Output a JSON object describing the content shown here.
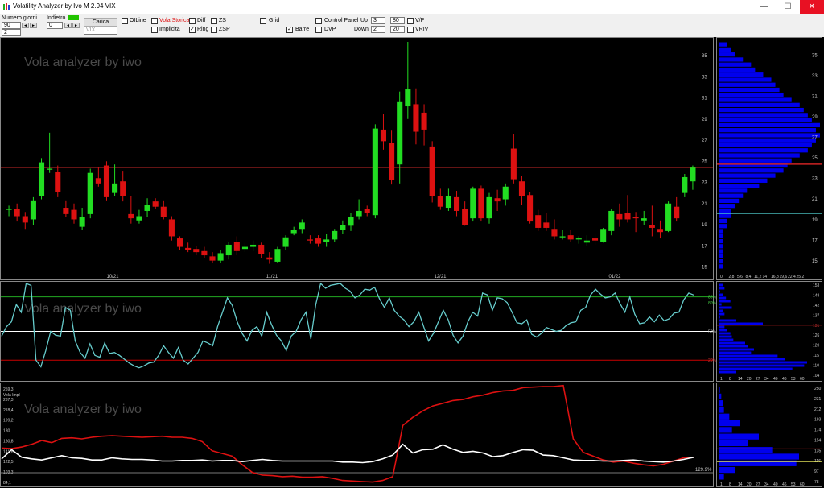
{
  "window": {
    "title": "Volatility Analyzer by Ivo M 2.94  VIX",
    "min": "—",
    "max": "☐",
    "close": "✕"
  },
  "toolbar": {
    "days_label": "Numero giorni",
    "days_value": "90",
    "days_value2": "2",
    "back_label": "Indietro",
    "back_value": "0",
    "load_label": "Carica",
    "symbol_placeholder": "VIX",
    "checks": {
      "oiline": "OILine",
      "vola_storica": "Vola Storica",
      "diff": "Diff",
      "zs": "ZS",
      "implicita": "Implicita",
      "ring": "Ring",
      "zsp": "ZSP",
      "grid": "Grid",
      "barre": "Barre",
      "control_panel": "Control Panel",
      "dvp": "DVP",
      "vp": "V/P",
      "vriv": "VRIV"
    },
    "up_label": "Up",
    "up_value": "3",
    "up_value2": "80",
    "down_label": "Down",
    "down_value": "2",
    "down_value2": "20"
  },
  "watermarks": [
    "Vola analyzer by iwo",
    "Vola analyzer by iwo",
    "Vola analyzer by iwo"
  ],
  "colors": {
    "up": "#22dd22",
    "down": "#dd1111",
    "hist": "#0000ee",
    "vola": "#66cccc",
    "implied": "#dd1111",
    "hv": "#ffffff",
    "line_green": "#22aa22",
    "line_red": "#cc0000"
  },
  "chart_data": [
    {
      "type": "candlestick",
      "title": "",
      "y_ticks": [
        35,
        33,
        31,
        29,
        27,
        25,
        23,
        21,
        19,
        17,
        15
      ],
      "x_labels": [
        "10/21",
        "11/21",
        "12/21",
        "01/22"
      ],
      "ylim": [
        14.2,
        36.3
      ],
      "reference_line": 24.4,
      "candles": [
        [
          20.4,
          20.8,
          19.8,
          20.5
        ],
        [
          20.5,
          21.0,
          19.3,
          19.8
        ],
        [
          19.8,
          20.2,
          18.6,
          19.2
        ],
        [
          19.5,
          21.6,
          19.0,
          21.3
        ],
        [
          21.7,
          25.3,
          21.4,
          24.9
        ],
        [
          24.2,
          27.7,
          23.9,
          24.3
        ],
        [
          24.0,
          24.6,
          21.6,
          22.1
        ],
        [
          20.6,
          21.3,
          19.7,
          20.0
        ],
        [
          20.4,
          21.0,
          19.1,
          19.5
        ],
        [
          18.8,
          20.6,
          18.5,
          19.7
        ],
        [
          20.0,
          24.3,
          19.6,
          23.9
        ],
        [
          23.4,
          24.4,
          22.6,
          22.9
        ],
        [
          24.6,
          25.0,
          21.3,
          21.6
        ],
        [
          22.0,
          24.7,
          21.7,
          22.9
        ],
        [
          23.1,
          24.1,
          21.2,
          21.7
        ],
        [
          20.0,
          21.7,
          19.1,
          19.6
        ],
        [
          19.4,
          20.4,
          19.1,
          19.8
        ],
        [
          20.3,
          21.5,
          19.7,
          20.9
        ],
        [
          21.2,
          21.5,
          20.5,
          20.7
        ],
        [
          20.7,
          21.3,
          19.5,
          19.7
        ],
        [
          19.5,
          19.8,
          17.5,
          17.9
        ],
        [
          17.7,
          17.9,
          16.6,
          16.9
        ],
        [
          16.8,
          17.3,
          16.4,
          16.6
        ],
        [
          16.7,
          17.0,
          16.1,
          16.4
        ],
        [
          16.5,
          16.9,
          15.8,
          16.1
        ],
        [
          16.0,
          16.4,
          15.4,
          15.6
        ],
        [
          15.6,
          16.6,
          15.4,
          16.3
        ],
        [
          16.1,
          17.4,
          15.7,
          17.1
        ],
        [
          17.4,
          17.9,
          16.1,
          16.5
        ],
        [
          16.7,
          17.3,
          16.4,
          16.9
        ],
        [
          16.9,
          17.5,
          16.5,
          17.1
        ],
        [
          17.1,
          17.3,
          15.8,
          16.2
        ],
        [
          15.9,
          16.4,
          15.3,
          15.7
        ],
        [
          15.5,
          16.9,
          15.4,
          16.7
        ],
        [
          16.9,
          18.0,
          16.6,
          17.8
        ],
        [
          18.2,
          18.8,
          18.0,
          18.5
        ],
        [
          18.6,
          19.5,
          18.2,
          19.2
        ],
        [
          17.6,
          18.0,
          17.2,
          17.5
        ],
        [
          17.7,
          18.0,
          16.9,
          17.2
        ],
        [
          17.4,
          18.1,
          16.9,
          17.6
        ],
        [
          17.6,
          18.6,
          17.4,
          18.4
        ],
        [
          18.5,
          19.4,
          18.1,
          19.0
        ],
        [
          18.9,
          20.1,
          18.4,
          19.7
        ],
        [
          19.8,
          21.4,
          19.5,
          20.3
        ],
        [
          20.5,
          20.8,
          19.8,
          20.1
        ],
        [
          19.9,
          28.5,
          19.6,
          28.1
        ],
        [
          28.0,
          29.5,
          26.1,
          26.9
        ],
        [
          26.7,
          27.9,
          22.8,
          23.2
        ],
        [
          24.7,
          31.6,
          22.9,
          30.6
        ],
        [
          30.2,
          36.3,
          29.0,
          31.8
        ],
        [
          30.4,
          31.9,
          26.6,
          27.8
        ],
        [
          29.6,
          30.4,
          26.5,
          28.0
        ],
        [
          26.4,
          26.9,
          21.1,
          21.7
        ],
        [
          21.7,
          22.4,
          20.4,
          20.7
        ],
        [
          20.6,
          22.4,
          20.3,
          21.7
        ],
        [
          21.6,
          22.2,
          19.8,
          20.3
        ],
        [
          20.5,
          21.2,
          18.9,
          19.0
        ],
        [
          19.6,
          22.6,
          19.3,
          22.4
        ],
        [
          22.4,
          22.7,
          19.3,
          19.6
        ],
        [
          19.6,
          22.0,
          19.1,
          21.6
        ],
        [
          21.5,
          22.3,
          20.3,
          21.2
        ],
        [
          21.4,
          22.9,
          20.8,
          22.6
        ],
        [
          26.2,
          27.6,
          22.9,
          23.3
        ],
        [
          23.1,
          23.6,
          20.9,
          21.7
        ],
        [
          21.8,
          22.1,
          19.1,
          19.3
        ],
        [
          19.9,
          20.4,
          18.4,
          18.7
        ],
        [
          19.2,
          20.1,
          18.4,
          18.7
        ],
        [
          18.6,
          19.5,
          17.6,
          17.9
        ],
        [
          17.8,
          18.5,
          17.6,
          17.9
        ],
        [
          18.0,
          18.5,
          17.4,
          17.6
        ],
        [
          17.6,
          17.9,
          17.2,
          17.7
        ],
        [
          17.3,
          18.0,
          17.0,
          17.5
        ],
        [
          17.7,
          18.1,
          17.1,
          17.5
        ],
        [
          17.4,
          18.7,
          17.3,
          18.6
        ],
        [
          18.4,
          20.5,
          18.0,
          20.3
        ],
        [
          20.0,
          21.0,
          18.8,
          19.5
        ],
        [
          20.1,
          21.8,
          19.2,
          19.5
        ],
        [
          19.7,
          20.2,
          18.3,
          19.6
        ],
        [
          19.4,
          20.3,
          19.0,
          19.6
        ],
        [
          19.0,
          20.8,
          17.9,
          18.7
        ],
        [
          18.6,
          19.4,
          17.7,
          18.3
        ],
        [
          18.4,
          21.2,
          18.3,
          21.0
        ],
        [
          20.7,
          21.6,
          19.3,
          19.6
        ],
        [
          22.0,
          23.8,
          21.6,
          23.5
        ],
        [
          23.1,
          24.6,
          22.3,
          24.4
        ]
      ],
      "profile_ticks": [
        35,
        33,
        31,
        29,
        27,
        25,
        23,
        21,
        19,
        17,
        15
      ],
      "profile_x_labels": [
        "0",
        "2,8",
        "5,6",
        "8,4",
        "11,2",
        "14",
        "16,8",
        "19,6",
        "22,4",
        "25,2"
      ],
      "profile_bins": [
        1,
        1,
        1,
        1,
        1,
        1,
        1,
        1,
        2,
        2,
        3,
        3,
        4,
        5,
        6,
        7,
        10,
        12,
        14,
        16,
        17,
        18,
        20,
        22,
        23,
        24,
        25,
        24,
        25,
        23,
        22,
        21,
        20,
        18,
        16,
        15,
        14,
        13,
        11,
        9,
        8,
        6,
        4,
        3,
        2
      ]
    },
    {
      "type": "line",
      "title": "",
      "y_levels": {
        "86%": 86,
        "80%": 80,
        "50%": 50,
        "20%": 20
      },
      "ylim": [
        0,
        100
      ],
      "values": [
        45,
        55,
        60,
        78,
        70,
        100,
        98,
        20,
        13,
        30,
        50,
        46,
        45,
        75,
        72,
        40,
        28,
        22,
        37,
        25,
        23,
        38,
        27,
        28,
        25,
        21,
        17,
        14,
        12,
        14,
        17,
        18,
        25,
        35,
        28,
        22,
        33,
        20,
        16,
        22,
        28,
        40,
        38,
        35,
        55,
        70,
        85,
        77,
        60,
        48,
        40,
        51,
        55,
        45,
        70,
        57,
        46,
        40,
        30,
        45,
        50,
        62,
        70,
        42,
        78,
        100,
        95,
        98,
        99,
        100,
        95,
        92,
        85,
        88,
        94,
        93,
        96,
        84,
        75,
        85,
        72,
        66,
        62,
        55,
        60,
        70,
        55,
        40,
        48,
        60,
        72,
        62,
        46,
        38,
        45,
        60,
        70,
        66,
        90,
        88,
        72,
        85,
        84,
        80,
        70,
        59,
        58,
        62,
        47,
        44,
        48,
        54,
        52,
        50,
        51,
        56,
        59,
        60,
        72,
        75,
        88,
        94,
        89,
        85,
        86,
        90,
        79,
        70,
        86,
        68,
        58,
        59,
        65,
        60,
        67,
        61,
        63,
        69,
        70,
        83,
        90,
        88
      ],
      "profile_ticks": [
        153,
        148,
        142,
        137,
        131,
        126,
        120,
        115,
        110,
        104
      ],
      "profile_x_labels": [
        "1",
        "8",
        "14",
        "20",
        "27",
        "34",
        "40",
        "46",
        "53",
        "60"
      ],
      "profile_bins": [
        3,
        4,
        1,
        3,
        5,
        8,
        2,
        9,
        3,
        4,
        1,
        12,
        30,
        4,
        6,
        8,
        9,
        10,
        18,
        20,
        24,
        22,
        40,
        45,
        60,
        58,
        50,
        12
      ]
    },
    {
      "type": "line",
      "title": "",
      "y_ticks": [
        "259,3",
        "237,3",
        "218,4",
        "199,2",
        "180",
        "160,8",
        "141,6",
        "122,5",
        "103,3",
        "84,1"
      ],
      "legend": [
        "Vola Impl"
      ],
      "series": [
        {
          "name": "Vola Impl",
          "values": [
            148,
            147,
            150,
            155,
            162,
            158,
            166,
            167,
            165,
            168,
            170,
            171,
            170,
            169,
            168,
            169,
            170,
            168,
            168,
            166,
            160,
            143,
            138,
            133,
            117,
            103,
            98,
            97,
            95,
            96,
            94,
            94,
            95,
            92,
            88,
            87,
            86,
            85,
            88,
            95,
            190,
            205,
            217,
            226,
            231,
            236,
            238,
            243,
            246,
            251,
            254,
            255,
            260,
            261,
            262,
            262,
            264,
            165,
            140,
            133,
            126,
            122,
            124,
            120,
            117,
            115,
            118,
            124,
            130,
            131
          ]
        },
        {
          "name": "",
          "values": [
            128,
            145,
            131,
            128,
            126,
            130,
            134,
            130,
            129,
            126,
            126,
            130,
            128,
            127,
            127,
            126,
            124,
            124,
            125,
            125,
            126,
            124,
            125,
            125,
            123,
            125,
            127,
            125,
            124,
            124,
            124,
            124,
            124,
            124,
            122,
            122,
            121,
            123,
            128,
            135,
            155,
            139,
            145,
            146,
            154,
            146,
            140,
            142,
            139,
            132,
            134,
            140,
            145,
            144,
            135,
            134,
            130,
            126,
            125,
            125,
            124,
            124,
            125,
            126,
            124,
            123,
            122,
            124,
            127,
            131
          ]
        }
      ],
      "current_label": "129.9%",
      "profile_ticks": [
        "250",
        "231",
        "212",
        "193",
        "174",
        "154",
        "135",
        "116",
        "97",
        "78"
      ],
      "profile_x_labels": [
        "1",
        "8",
        "14",
        "20",
        "27",
        "34",
        "40",
        "46",
        "53",
        "60"
      ],
      "profile_bins": [
        1,
        2,
        3,
        4,
        8,
        16,
        10,
        30,
        22,
        40,
        60,
        58,
        12,
        4
      ]
    }
  ]
}
